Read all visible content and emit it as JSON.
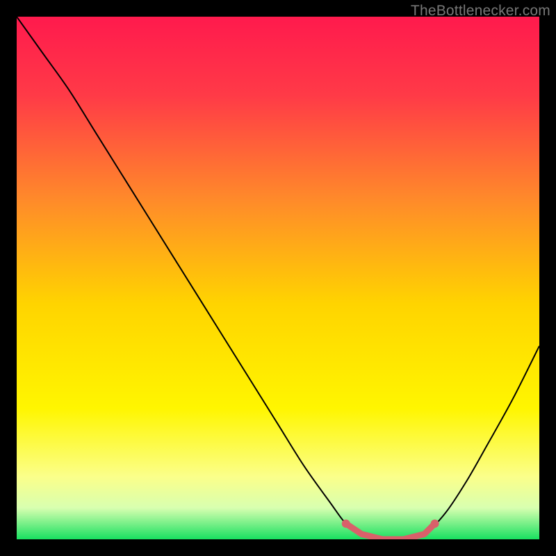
{
  "watermark": "TheBottlenecker.com",
  "chart_data": {
    "type": "line",
    "title": "",
    "xlabel": "",
    "ylabel": "",
    "xlim": [
      0,
      100
    ],
    "ylim": [
      0,
      100
    ],
    "grid": false,
    "background": {
      "type": "vertical-gradient",
      "stops": [
        {
          "pos": 0.0,
          "color": "#ff1a4d"
        },
        {
          "pos": 0.15,
          "color": "#ff3a47"
        },
        {
          "pos": 0.35,
          "color": "#ff8a2a"
        },
        {
          "pos": 0.55,
          "color": "#ffd400"
        },
        {
          "pos": 0.75,
          "color": "#fff600"
        },
        {
          "pos": 0.88,
          "color": "#fbff8a"
        },
        {
          "pos": 0.94,
          "color": "#d8ffb0"
        },
        {
          "pos": 1.0,
          "color": "#18e060"
        }
      ]
    },
    "series": [
      {
        "name": "bottleneck-curve",
        "color": "#000000",
        "x": [
          0,
          5,
          10,
          15,
          20,
          25,
          30,
          35,
          40,
          45,
          50,
          55,
          60,
          63,
          66,
          70,
          74,
          78,
          82,
          86,
          90,
          95,
          100
        ],
        "y": [
          100,
          93,
          86,
          78,
          70,
          62,
          54,
          46,
          38,
          30,
          22,
          14,
          7,
          3,
          1,
          0,
          0,
          1,
          5,
          11,
          18,
          27,
          37
        ]
      },
      {
        "name": "optimal-band",
        "color": "#d9606a",
        "x": [
          63,
          66,
          70,
          74,
          78,
          80
        ],
        "y": [
          3,
          1,
          0,
          0,
          1,
          3
        ]
      }
    ],
    "annotations": []
  }
}
